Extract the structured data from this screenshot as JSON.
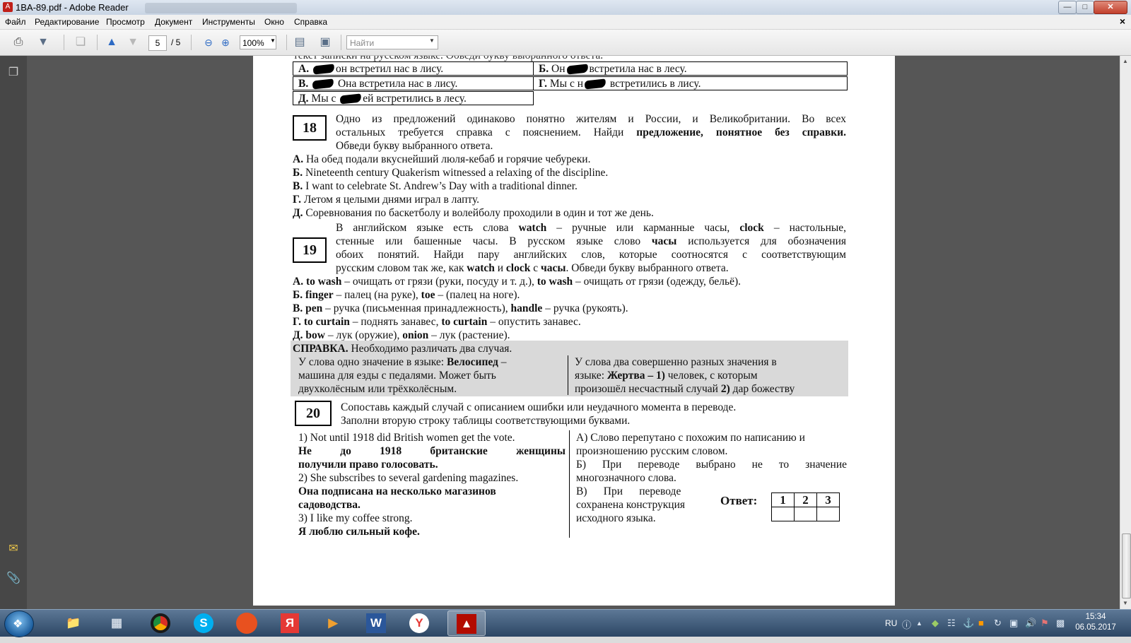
{
  "window": {
    "title": "1BA-89.pdf - Adobe Reader",
    "minimize_icon": "minimize-icon",
    "maximize_icon": "maximize-icon",
    "close_icon": "close-icon"
  },
  "menu": [
    "Файл",
    "Редактирование",
    "Просмотр",
    "Документ",
    "Инструменты",
    "Окно",
    "Справка"
  ],
  "toolbar": {
    "current_page": "5",
    "total_pages": "/ 5",
    "zoom": "100%",
    "search_placeholder": "Найти"
  },
  "page": {
    "top_cutoff": "текст записки на русском языке. Обведи букву выбранного ответа.",
    "q17": {
      "a_label": "А.",
      "a_text": "он встретил нас в лису.",
      "b_label": "Б.",
      "b_pre": "Он",
      "b_text": "встретила нас в лесу.",
      "v_label": "В.",
      "v_text": "Она встретила нас в лису.",
      "g_label": "Г.",
      "g_pre": "Мы с н",
      "g_text": "встретились в лису.",
      "d_label": "Д.",
      "d_pre": "Мы с",
      "d_text": "ей встретились в лесу."
    },
    "q18": {
      "number": "18",
      "line1": "Одно из предложений одинаково понятно жителям и России, и Великобритании. Во всех",
      "line2_pre": "остальных требуется справка с пояснением. Найди",
      "line2_bold": "предложение, понятное без справки.",
      "line3": "Обведи букву выбранного ответа.",
      "options": [
        {
          "label": "А.",
          "text": "На обед подали вкуснейший люля-кебаб и горячие чебуреки."
        },
        {
          "label": "Б.",
          "text": "Nineteenth century Quakerism witnessed a relaxing of the discipline."
        },
        {
          "label": "В.",
          "text": "I want to celebrate St. Andrew’s Day with a traditional dinner."
        },
        {
          "label": "Г.",
          "text": "Летом я целыми днями играл в лапту."
        },
        {
          "label": "Д.",
          "text": "Соревнования по баскетболу и волейболу проходили в один и тот же день."
        }
      ]
    },
    "q19": {
      "number": "19",
      "l1_a": "В английском языке есть слова",
      "l1_b": "watch",
      "l1_c": "– ручные или карманные часы,",
      "l1_d": "clock",
      "l1_e": "– настольные,",
      "l2_a": "стенные или башенные часы. В русском языке слово",
      "l2_b": "часы",
      "l2_c": "используется для обозначения",
      "l3": "обоих понятий. Найди пару английских слов, которые соотносятся с соответствующим",
      "l4_a": "русским словом так же, как",
      "l4_b": "watch",
      "l4_c": "и",
      "l4_d": "clock",
      "l4_e": "с",
      "l4_f": "часы",
      "l4_g": ". Обведи букву выбранного ответа.",
      "options": [
        {
          "label": "А.",
          "w1": "to wash",
          "t1": "– очищать от грязи (руки, посуду и т. д.),",
          "w2": "to wash",
          "t2": "– очищать от грязи (одежду, бельё)."
        },
        {
          "label": "Б.",
          "w1": "finger",
          "t1": "– палец (на руке),",
          "w2": "toe",
          "t2": "– (палец на ноге)."
        },
        {
          "label": "В.",
          "w1": "pen",
          "t1": "– ручка (письменная принадлежность),",
          "w2": "handle",
          "t2": "– ручка (рукоять)."
        },
        {
          "label": "Г.",
          "w1": "to curtain",
          "t1": "– поднять занавес,",
          "w2": "to curtain",
          "t2": "– опустить занавес."
        },
        {
          "label": "Д.",
          "w1": "bow",
          "t1": "– лук (оружие),",
          "w2": "onion",
          "t2": "– лук (растение)."
        }
      ]
    },
    "help": {
      "title": "СПРАВКА.",
      "title_rest": "Необходимо различать два случая.",
      "left_l1_a": "У слова одно значение в языке:",
      "left_l1_b": "Велосипед",
      "left_l1_c": "–",
      "left_l2": "машина для езды с педалями. Может быть",
      "left_l3": "двухколёсным или трёхколёсным.",
      "right_l1": "У слова два совершенно разных значения в",
      "right_l2_a": "языке:",
      "right_l2_b": "Жертва – 1)",
      "right_l2_c": "человек, с которым",
      "right_l3_a": "произошёл несчастный случай",
      "right_l3_b": "2)",
      "right_l3_c": "дар божеству"
    },
    "q20": {
      "number": "20",
      "intro1": "Сопоставь каждый случай с описанием ошибки или неудачного момента в переводе.",
      "intro2": "Заполни вторую строку таблицы соответствующими буквами.",
      "s1": "1) Not until 1918 did British women get the vote.",
      "s1_tr_a": "Не до 1918 британские женщины",
      "s1_tr_b": "получили право голосовать.",
      "s2": "2)  She subscribes to several gardening magazines.",
      "s2_tr_a": "Она подписана на несколько магазинов",
      "s2_tr_b": "садоводства.",
      "s3": "3) I like my coffee strong.",
      "s3_tr": "Я люблю сильный кофе.",
      "ra1": "А) Слово перепутано с похожим по написанию и",
      "ra2": "произношению русским словом.",
      "rb1": "Б)  При переводе выбрано не то значение",
      "rb2": "многозначного слова.",
      "rv1": "В)      При      переводе",
      "rv2": "сохранена конструкция",
      "rv3": "исходного языка.",
      "answer_label": "Ответ:",
      "answer_cols": [
        "1",
        "2",
        "3"
      ]
    }
  },
  "taskbar": {
    "apps": [
      {
        "name": "explorer",
        "icon": "folder-icon"
      },
      {
        "name": "calculator",
        "icon": "calculator-icon"
      },
      {
        "name": "chrome",
        "icon": "chrome-icon"
      },
      {
        "name": "skype",
        "icon": "skype-icon",
        "glyph": "S"
      },
      {
        "name": "app-orange",
        "icon": "orange-app-icon"
      },
      {
        "name": "yandex",
        "icon": "yandex-icon",
        "glyph": "Я"
      },
      {
        "name": "media-player",
        "icon": "media-player-icon"
      },
      {
        "name": "word",
        "icon": "word-icon",
        "glyph": "W"
      },
      {
        "name": "yandex-browser",
        "icon": "yandex-browser-icon",
        "glyph": "Y"
      },
      {
        "name": "adobe-reader",
        "icon": "adobe-reader-icon"
      }
    ],
    "language": "RU",
    "time": "15:34",
    "date": "06.05.2017"
  }
}
